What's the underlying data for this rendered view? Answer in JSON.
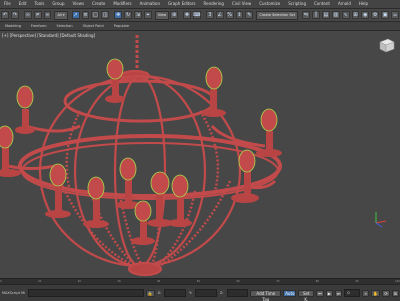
{
  "menubar": {
    "items": [
      "File",
      "Edit",
      "Tools",
      "Group",
      "Views",
      "Create",
      "Modifiers",
      "Animation",
      "Graph Editors",
      "Rendering",
      "Civil View",
      "Customize",
      "Scripting",
      "Content",
      "Arnold",
      "Help"
    ]
  },
  "toolbar": {
    "view_dropdown": "View",
    "selection_set_dropdown": "Create Selection Set"
  },
  "subbar": {
    "items": [
      "Modeling",
      "Freeform",
      "Selection",
      "Object Paint",
      "Populate"
    ]
  },
  "viewport": {
    "label": "[+] [Perspective] [Standard] [Default Shading]"
  },
  "timeline": {
    "ticks": [
      "0",
      "10",
      "20",
      "30",
      "40",
      "50",
      "60",
      "70",
      "80",
      "90",
      "100"
    ]
  },
  "statusbar": {
    "script_label": "MAXScript Mi",
    "x_label": "X:",
    "y_label": "Y:",
    "z_label": "Z:",
    "add_time_tag": "Add Time Tag",
    "auto_key": "Auto",
    "set_key": "Set K.",
    "frame_value": "0"
  },
  "colors": {
    "model": "#c24a4a",
    "model_dark": "#8f2a2a",
    "bulb_highlight": "#a8d84a",
    "viewport_bg": "#474747",
    "accent": "#3f6fa6"
  }
}
